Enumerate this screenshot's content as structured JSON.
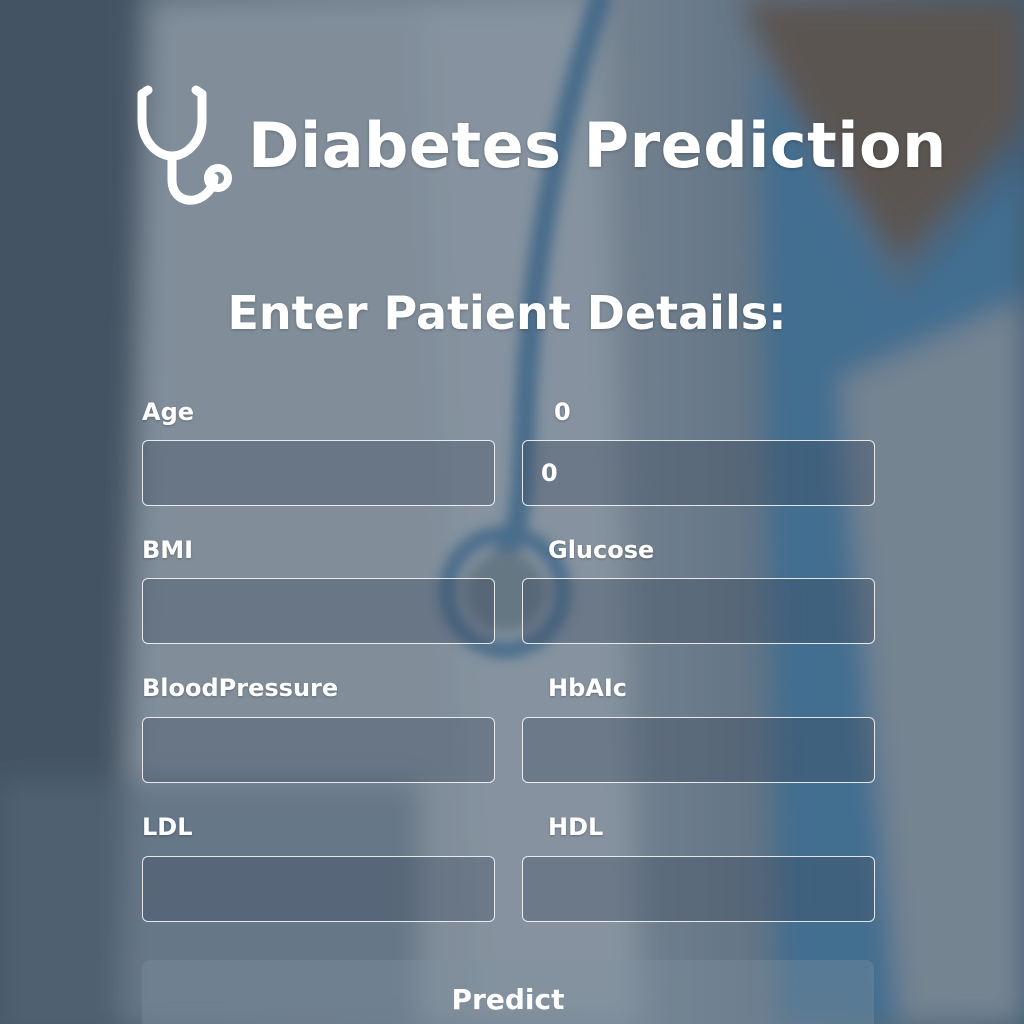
{
  "app": {
    "title": "Diabetes Prediction",
    "logo_icon": "stethoscope-icon"
  },
  "form": {
    "heading": "Enter Patient Details:",
    "fields": [
      {
        "label": "Age",
        "value": "",
        "placeholder": ""
      },
      {
        "label": "0",
        "value": "0",
        "placeholder": ""
      },
      {
        "label": "BMI",
        "value": "",
        "placeholder": ""
      },
      {
        "label": "Glucose",
        "value": "",
        "placeholder": ""
      },
      {
        "label": "BloodPressure",
        "value": "",
        "placeholder": ""
      },
      {
        "label": "HbAIc",
        "value": "",
        "placeholder": ""
      },
      {
        "label": "LDL",
        "value": "",
        "placeholder": ""
      },
      {
        "label": "HDL",
        "value": "",
        "placeholder": ""
      }
    ],
    "submit_label": "Predict"
  },
  "colors": {
    "overlay": "#5a6878",
    "scrubs": "#3d6f95",
    "text": "#ffffff"
  }
}
